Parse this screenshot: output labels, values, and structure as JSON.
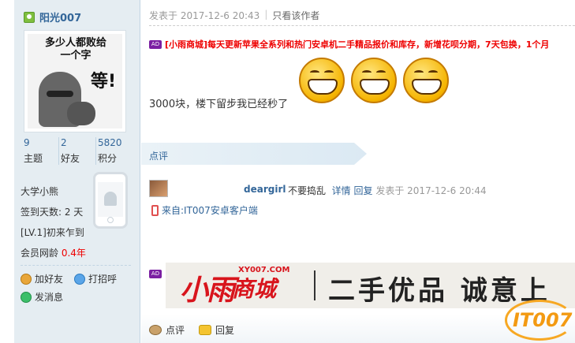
{
  "user": {
    "name": "阳光007",
    "stats": [
      {
        "value": "9",
        "label": "主题"
      },
      {
        "value": "2",
        "label": "好友"
      },
      {
        "value": "5820",
        "label": "积分"
      }
    ],
    "group": "大学小熊",
    "signin_days": "签到天数: 2 天",
    "level": "[LV.1]初来乍到",
    "age_label": "会员网龄",
    "age_value": "0.4年",
    "actions": {
      "add_friend": "加好友",
      "greet": "打招呼",
      "message": "发消息"
    },
    "avatar_text": "多少人都败给\n一个字",
    "avatar_big": "等!"
  },
  "post": {
    "meta_time": "发表于 2017-12-6 20:43",
    "meta_only_author": "只看该作者",
    "ad_tag": "AD",
    "ad_text": "[小雨商城]每天更新苹果全系列和热门安卓机二手精品报价和库存，新增花呗分期，7天包换，1个月",
    "body": "3000块，楼下留步我已经秒了"
  },
  "dianping": {
    "label": "点评",
    "comment": {
      "user": "deargirl",
      "text": "不要捣乱",
      "detail": "详情",
      "reply": "回复",
      "time": "发表于 2017-12-6 20:44"
    },
    "from": "来自:IT007安卓客户端"
  },
  "banner": {
    "brand": "小雨",
    "shop": "商城",
    "url": "XY007.COM",
    "slogan": "二手优品 诚意上"
  },
  "footer": {
    "comment": "点评",
    "reply": "回复"
  },
  "watermark": "IT007"
}
